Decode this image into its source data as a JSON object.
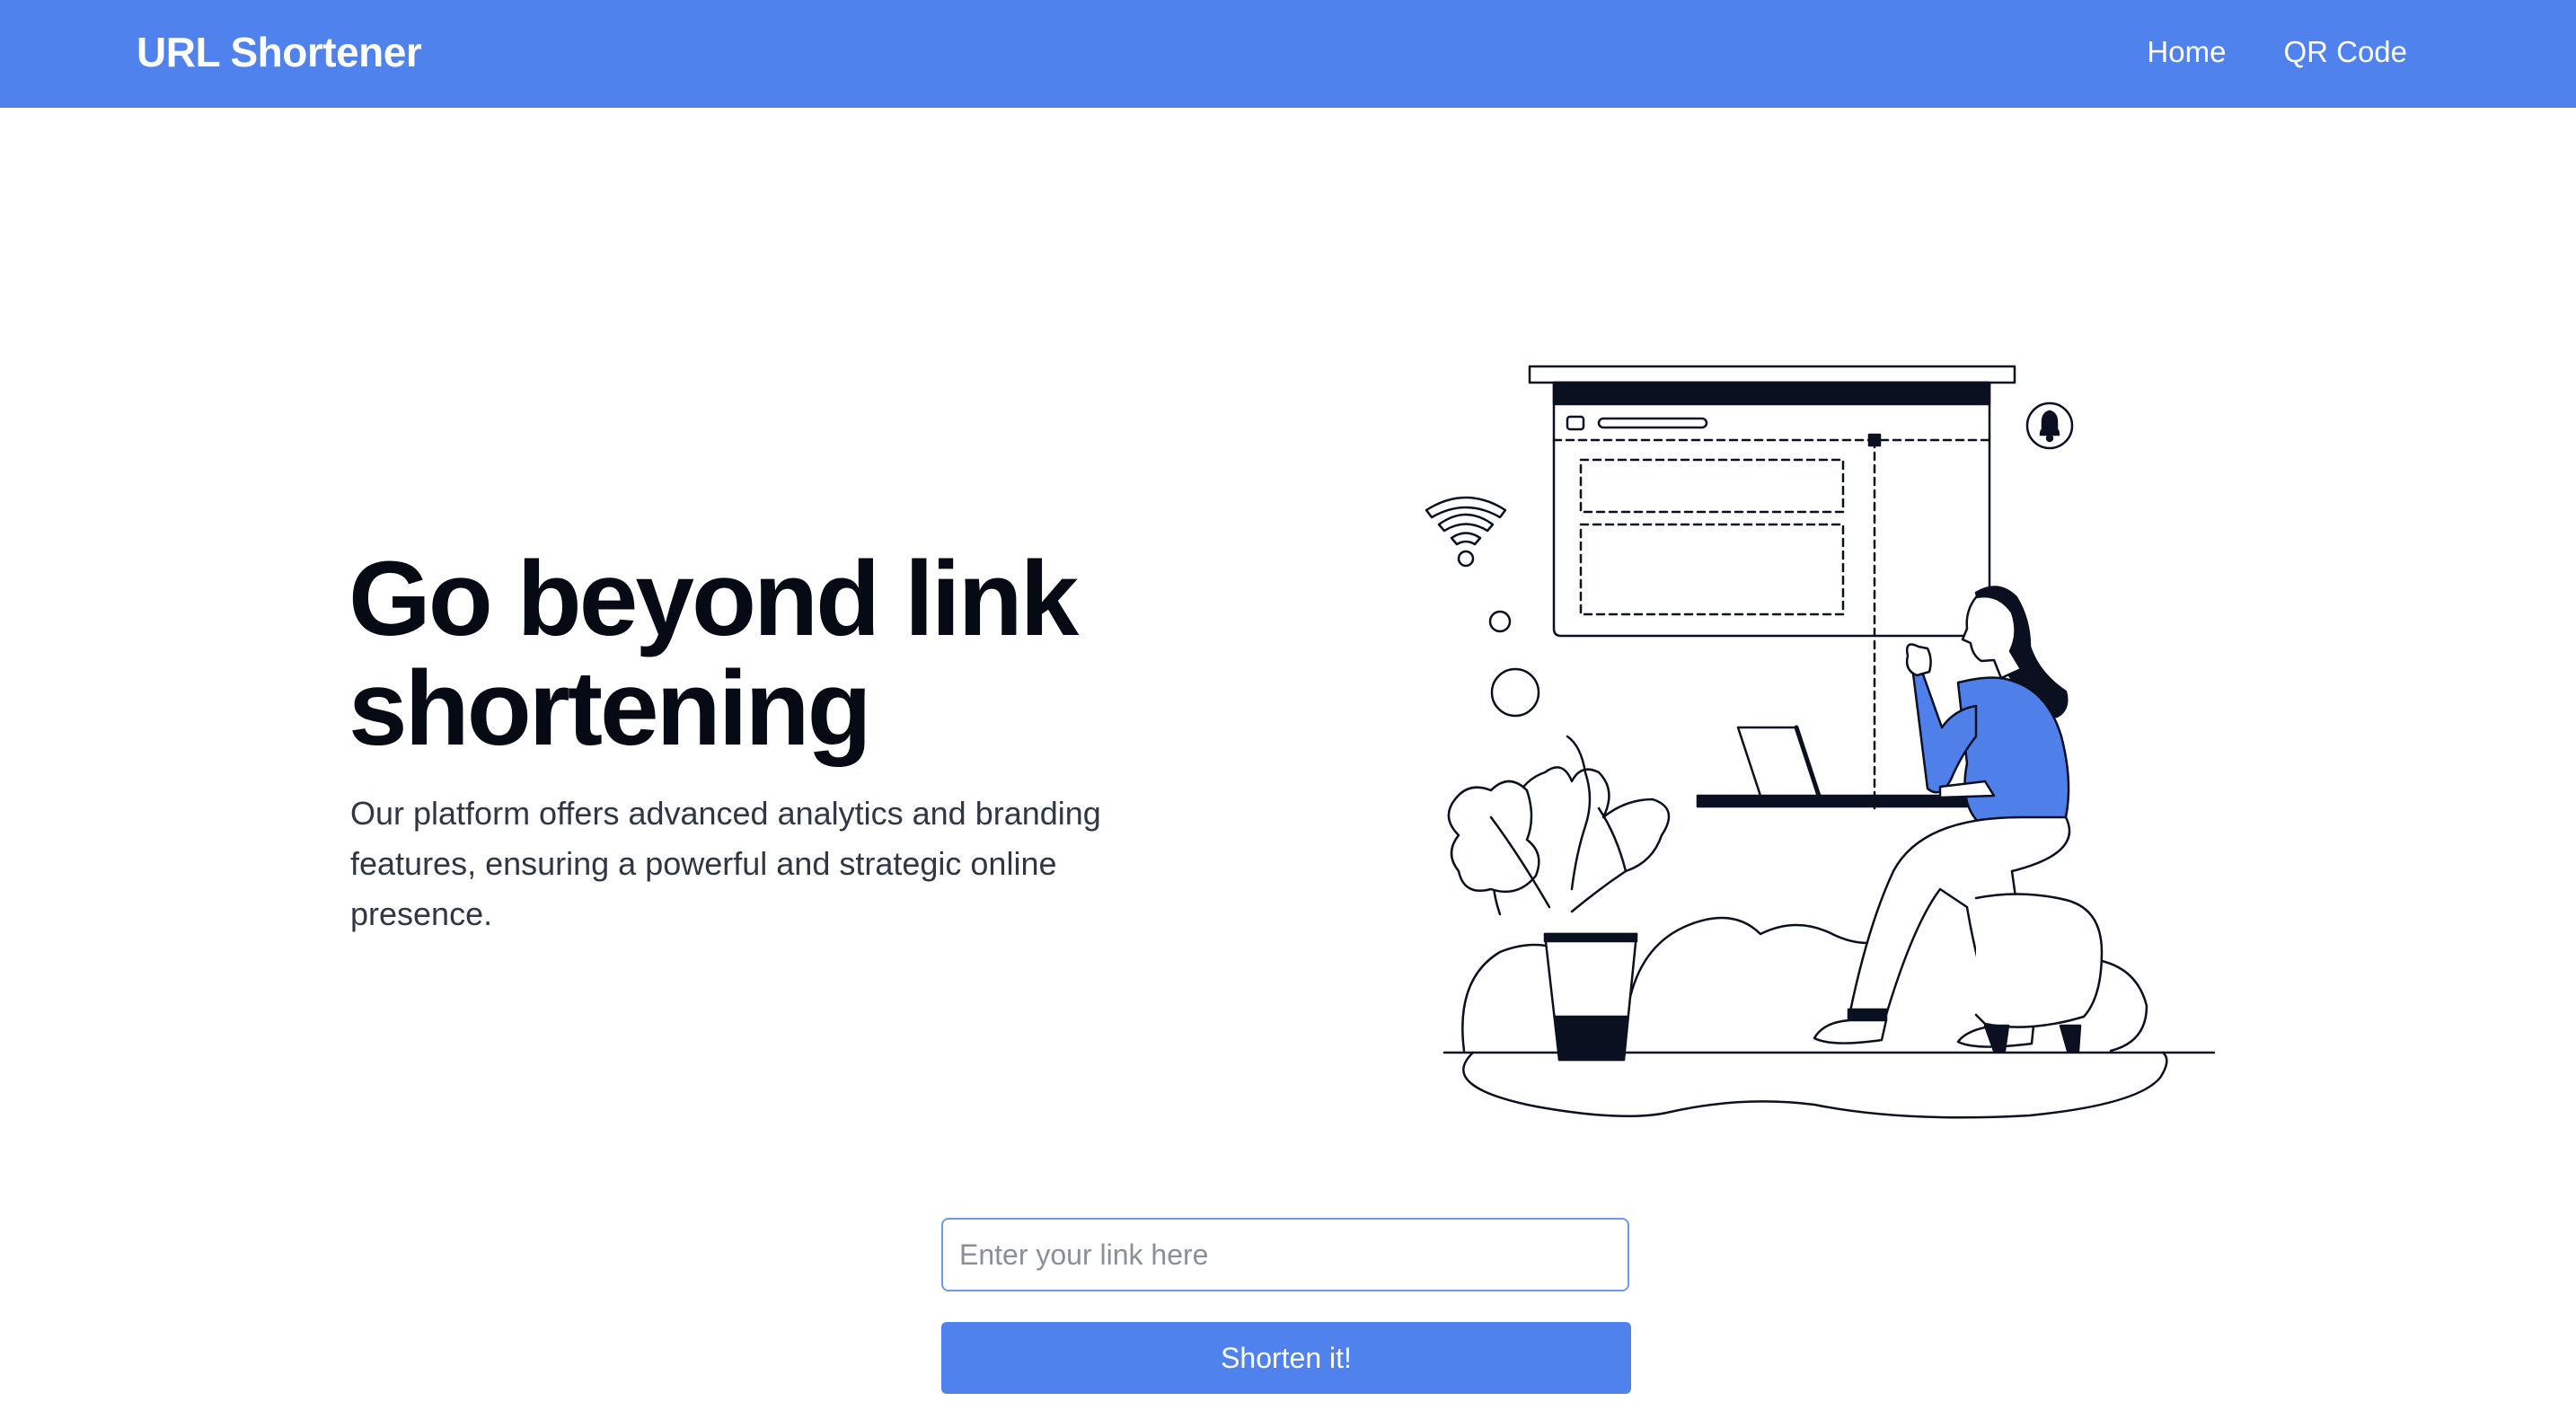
{
  "navbar": {
    "brand": "URL Shortener",
    "links": [
      {
        "label": "Home"
      },
      {
        "label": "QR Code"
      }
    ]
  },
  "hero": {
    "title": "Go beyond link shortening",
    "description": "Our platform offers advanced analytics and branding features, ensuring a powerful and strategic online presence."
  },
  "form": {
    "input_value": "",
    "input_placeholder": "Enter your link here",
    "button_label": "Shorten it!"
  },
  "colors": {
    "primary": "#4f82ed",
    "heading": "#050a14",
    "body_text": "#2f3744",
    "illustration_accent": "#4f7fe8",
    "illustration_dark": "#0a1020"
  },
  "icons": [
    "wifi-icon",
    "bell-icon"
  ]
}
